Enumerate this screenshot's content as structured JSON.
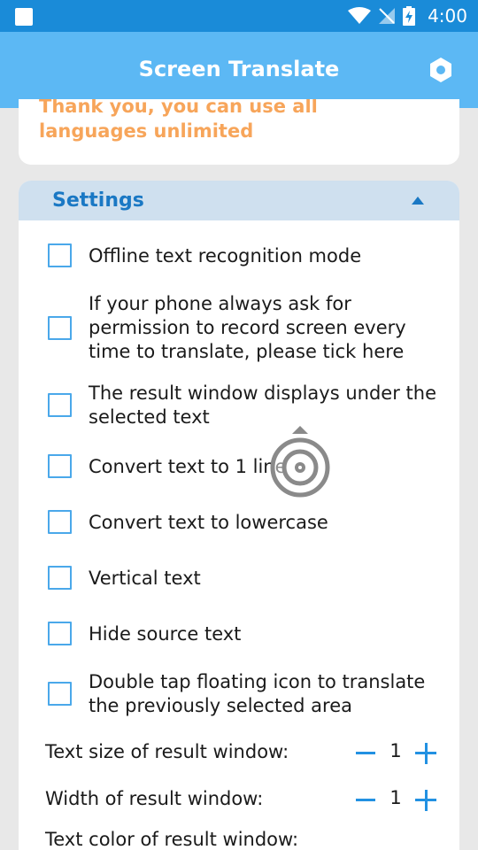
{
  "status": {
    "time": "4:00"
  },
  "app": {
    "title": "Screen Translate"
  },
  "banner": {
    "message": "Thank you, you can use all languages unlimited"
  },
  "settings": {
    "title": "Settings",
    "options": [
      {
        "label": "Offline text recognition mode",
        "checked": false
      },
      {
        "label": "If your phone always ask for permission to record screen every time to translate, please tick here",
        "checked": false
      },
      {
        "label": "The result window displays under the selected text",
        "checked": false
      },
      {
        "label": "Convert text to 1 line",
        "checked": false
      },
      {
        "label": "Convert text to lowercase",
        "checked": false
      },
      {
        "label": "Vertical text",
        "checked": false
      },
      {
        "label": "Hide source text",
        "checked": false
      },
      {
        "label": "Double tap floating icon to translate the previously selected area",
        "checked": false
      }
    ],
    "text_size": {
      "label": "Text size of result window:",
      "value": "1"
    },
    "width": {
      "label": "Width of result window:",
      "value": "1"
    },
    "text_color": {
      "label": "Text color of result window:"
    }
  },
  "colors": {
    "statusbar": "#1a8bd8",
    "appbar": "#5cb8f4",
    "accent": "#2291e2",
    "banner_text": "#f7a55a"
  }
}
